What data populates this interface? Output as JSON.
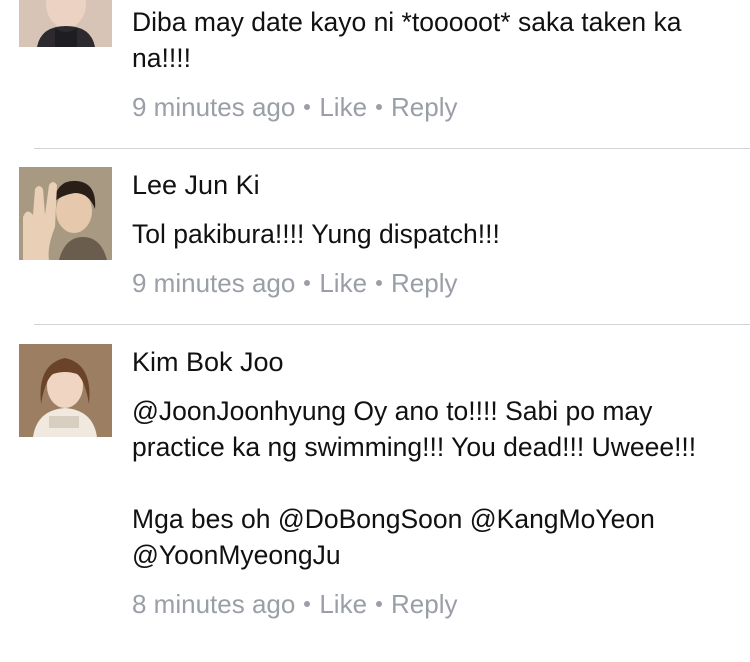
{
  "comments": [
    {
      "name": "",
      "text": "Diba may date kayo ni *tooooot* saka taken ka na!!!!",
      "time": "9 minutes ago",
      "like": "Like",
      "reply": "Reply"
    },
    {
      "name": "Lee Jun Ki",
      "text": "Tol pakibura!!!! Yung dispatch!!!",
      "time": "9 minutes ago",
      "like": "Like",
      "reply": "Reply"
    },
    {
      "name": "Kim Bok Joo",
      "text": "@JoonJoonhyung Oy ano to!!!!  Sabi po may practice ka ng swimming!!! You dead!!! Uweee!!!\n\nMga bes oh @DoBongSoon @KangMoYeon @YoonMyeongJu",
      "time": "8 minutes ago",
      "like": "Like",
      "reply": "Reply"
    }
  ],
  "colors": {
    "text": "#111111",
    "meta": "#9a9ea6",
    "divider": "#d3d5d9"
  }
}
